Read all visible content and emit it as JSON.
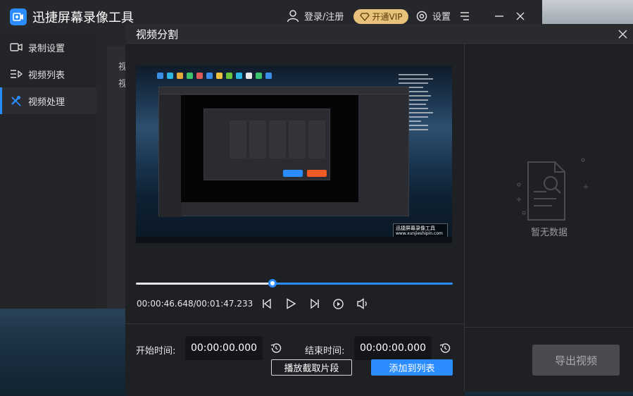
{
  "app": {
    "title": "迅捷屏幕录像工具",
    "login_label": "登录/注册",
    "vip_label": "开通VIP",
    "settings_label": "设置"
  },
  "sidebar": {
    "items": [
      {
        "label": "录制设置",
        "icon": "camera-icon"
      },
      {
        "label": "视频列表",
        "icon": "list-icon"
      },
      {
        "label": "视频处理",
        "icon": "tools-icon",
        "active": true
      }
    ]
  },
  "main_panel": {
    "line1": "视",
    "line2": "视"
  },
  "dialog": {
    "title": "视频分割",
    "player": {
      "current_time": "00:00:46.648",
      "total_time": "00:01:47.233",
      "time_display": "00:00:46.648/00:01:47.233",
      "progress": 0.43
    },
    "preview": {
      "watermark_line1": "迅捷屏幕录像工具",
      "watermark_line2": "www.xunjieshipin.com"
    },
    "start_label": "开始时间:",
    "start_value": "00:00:00.000",
    "end_label": "结束时间:",
    "end_value": "00:00:00.000",
    "play_clip_button": "播放截取片段",
    "add_to_list_button": "添加到列表",
    "empty_text": "暂无数据",
    "export_button": "导出视频"
  },
  "colors": {
    "accent": "#2a8cff",
    "vip": "#e8c27a",
    "background": "#1f2023"
  }
}
